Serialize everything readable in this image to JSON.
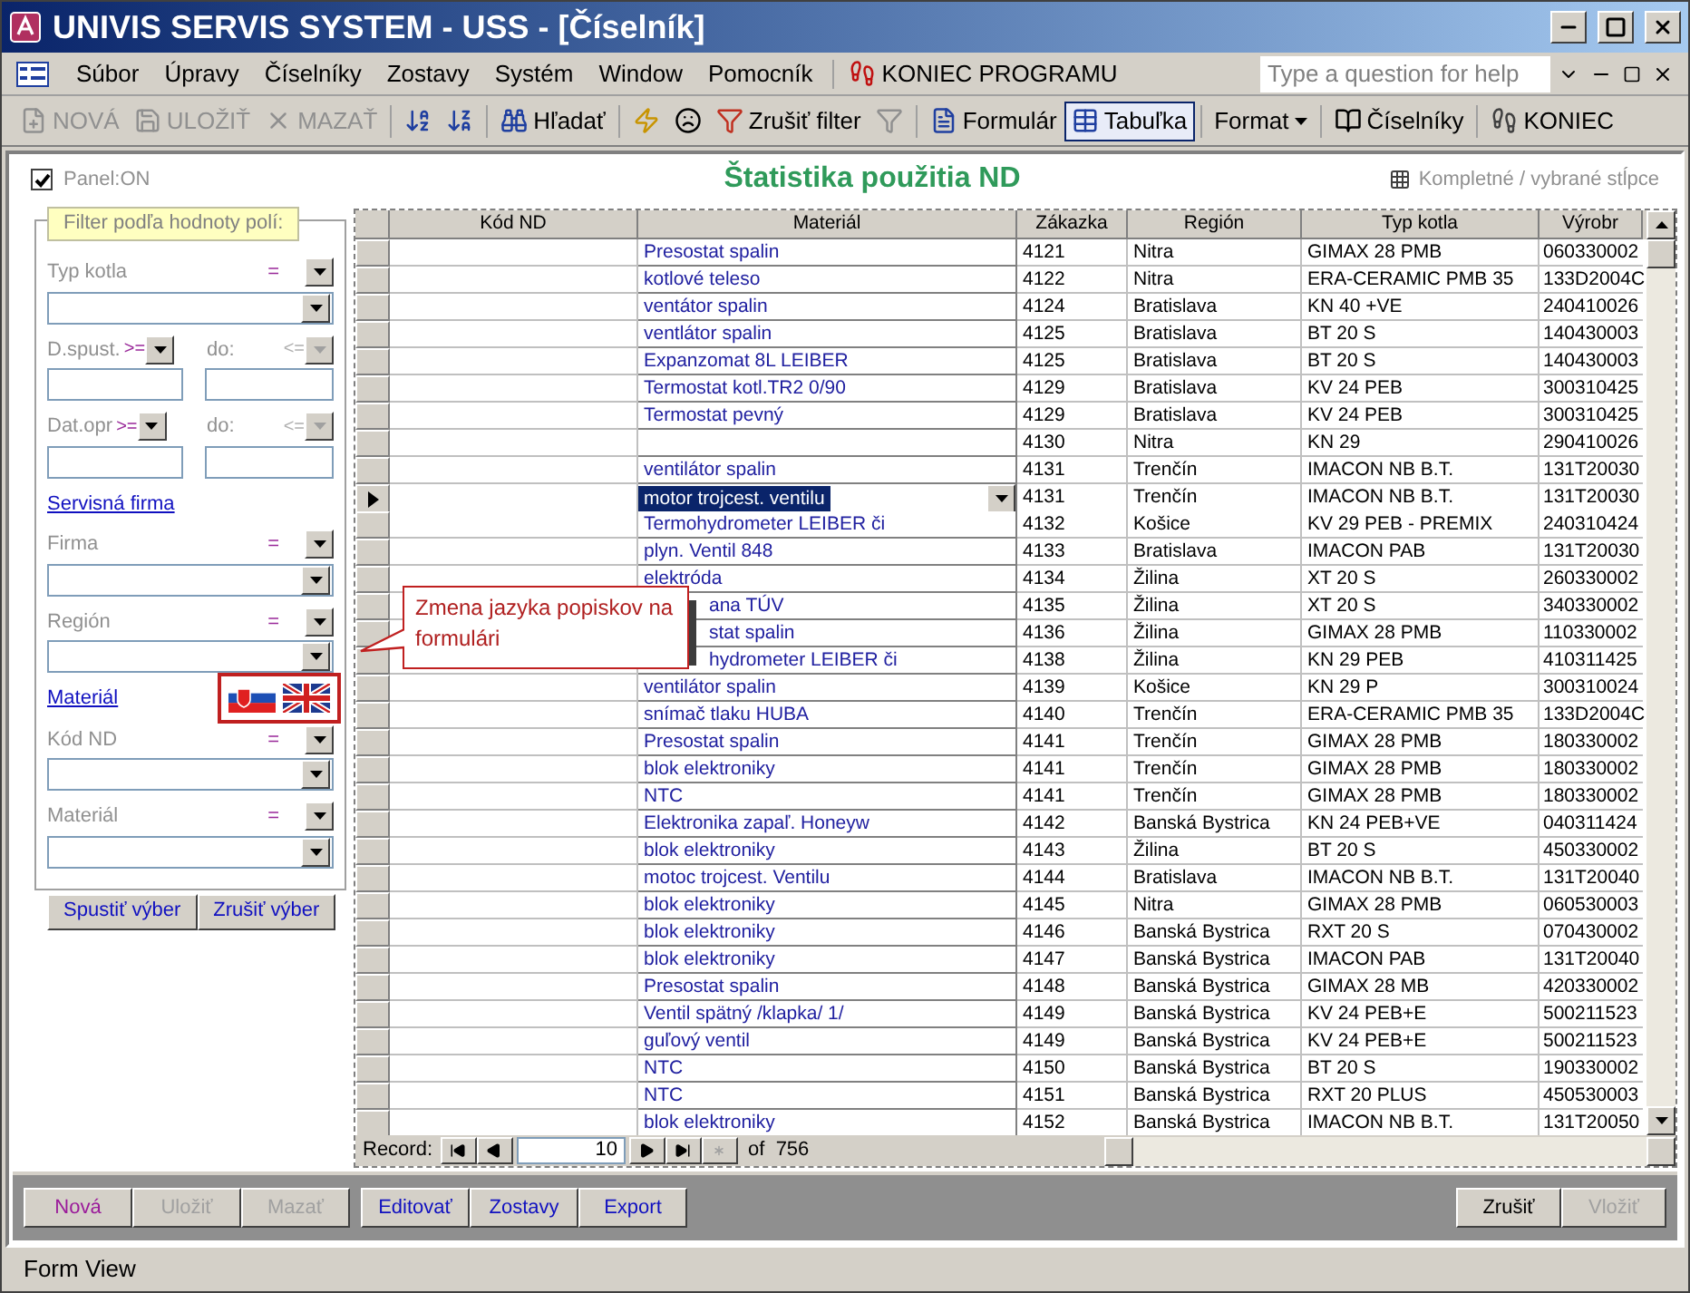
{
  "window": {
    "title": "UNIVIS SERVIS SYSTEM - USS - [Číselník]"
  },
  "menu": {
    "items": [
      "Súbor",
      "Úpravy",
      "Číselníky",
      "Zostavy",
      "Systém",
      "Window",
      "Pomocník"
    ],
    "exit": "KONIEC PROGRAMU",
    "help": {
      "placeholder": "Type a question for help"
    }
  },
  "toolbar": [
    {
      "kind": "new",
      "label": "NOVÁ",
      "disabled": true,
      "selected": false
    },
    {
      "kind": "save",
      "label": "ULOŽIŤ",
      "disabled": true,
      "selected": false
    },
    {
      "kind": "delete",
      "label": "MAZAŤ",
      "disabled": true,
      "selected": false
    },
    {
      "kind": "sortasc",
      "disabled": false,
      "selected": false
    },
    {
      "kind": "sortdesc",
      "disabled": false,
      "selected": false
    },
    {
      "kind": "find",
      "label": "Hľadať",
      "disabled": false,
      "selected": false
    },
    {
      "kind": "lightning",
      "disabled": false,
      "selected": false
    },
    {
      "kind": "face",
      "disabled": false,
      "selected": false
    },
    {
      "kind": "clearfilter",
      "label": "Zrušiť filter",
      "disabled": false,
      "selected": false
    },
    {
      "kind": "filter",
      "disabled": true,
      "selected": false
    },
    {
      "kind": "form",
      "label": "Formulár",
      "disabled": false,
      "selected": false
    },
    {
      "kind": "table",
      "label": "Tabuľka",
      "disabled": false,
      "selected": true
    },
    {
      "kind": "format",
      "label": "Format",
      "disabled": false,
      "selected": false
    },
    {
      "kind": "lists",
      "label": "Číselníky",
      "disabled": false,
      "selected": false
    },
    {
      "kind": "exit",
      "label": "KONIEC",
      "disabled": false,
      "selected": false
    }
  ],
  "header": {
    "panel": {
      "label": "Panel:ON",
      "checked": true
    },
    "title": "Štatistika použitia ND",
    "columns_toggle": "Kompletné / vybrané stĺpce"
  },
  "filter": {
    "legend": "Filter podľa hodnoty polí:",
    "items": [
      {
        "kind": "combo",
        "label": "Typ kotla",
        "operator": "="
      },
      {
        "kind": "range",
        "label": "D.spust.",
        "from_op": ">=",
        "to_label": "do:",
        "to_op": "<=",
        "to_disabled": true
      },
      {
        "kind": "range",
        "label": "Dat.opr",
        "from_op": ">=",
        "to_label": "do:",
        "to_op": "<=",
        "to_disabled": true
      },
      {
        "kind": "link",
        "label": "Servisná firma",
        "language_flags": false
      },
      {
        "kind": "combo",
        "label": "Firma",
        "operator": "="
      },
      {
        "kind": "combo",
        "label": "Región",
        "operator": "="
      },
      {
        "kind": "link",
        "label": "Materiál",
        "language_flags": true
      },
      {
        "kind": "combo",
        "label": "Kód ND",
        "operator": "="
      },
      {
        "kind": "combo",
        "label": "Materiál",
        "operator": "="
      }
    ],
    "buttons": [
      "Spustiť výber",
      "Zrušiť výber"
    ]
  },
  "callout": {
    "text": "Zmena jazyka popiskov na formulári"
  },
  "table": {
    "columns": [
      "Kód ND",
      "Materiál",
      "Zákazka",
      "Región",
      "Typ kotla",
      "Výrobr"
    ],
    "rows": [
      {
        "material": "Presostat spalin",
        "order": "4121",
        "region": "Nitra",
        "boiler": "GIMAX 28 PMB",
        "serial": "060330002",
        "current": false,
        "covered": false
      },
      {
        "material": "kotlové teleso",
        "order": "4122",
        "region": "Nitra",
        "boiler": "ERA-CERAMIC PMB 35",
        "serial": "133D2004C",
        "current": false,
        "covered": false
      },
      {
        "material": "ventátor spalin",
        "order": "4124",
        "region": "Bratislava",
        "boiler": "KN 40 +VE",
        "serial": "240410026",
        "current": false,
        "covered": false
      },
      {
        "material": "ventlátor spalin",
        "order": "4125",
        "region": "Bratislava",
        "boiler": "BT 20 S",
        "serial": "140430003",
        "current": false,
        "covered": false
      },
      {
        "material": "Expanzomat 8L LEIBER",
        "order": "4125",
        "region": "Bratislava",
        "boiler": "BT 20 S",
        "serial": "140430003",
        "current": false,
        "covered": false
      },
      {
        "material": "Termostat kotl.TR2 0/90",
        "order": "4129",
        "region": "Bratislava",
        "boiler": "KV 24 PEB",
        "serial": "300310425",
        "current": false,
        "covered": false
      },
      {
        "material": "Termostat pevný",
        "order": "4129",
        "region": "Bratislava",
        "boiler": "KV 24 PEB",
        "serial": "300310425",
        "current": false,
        "covered": false
      },
      {
        "order": "4130",
        "region": "Nitra",
        "boiler": "KN 29",
        "serial": "290410026",
        "current": false,
        "covered": false
      },
      {
        "material": "ventilátor spalin",
        "order": "4131",
        "region": "Trenčín",
        "boiler": "IMACON NB B.T.",
        "serial": "131T20030",
        "current": false,
        "covered": false
      },
      {
        "material": "motor trojcest. ventilu",
        "order": "4131",
        "region": "Trenčín",
        "boiler": "IMACON NB B.T.",
        "serial": "131T20030",
        "current": true,
        "covered": false
      },
      {
        "material": "Termohydrometer LEIBER či",
        "order": "4132",
        "region": "Košice",
        "boiler": "KV 29 PEB - PREMIX",
        "serial": "240310424",
        "current": false,
        "covered": false
      },
      {
        "material": "plyn. Ventil 848",
        "order": "4133",
        "region": "Bratislava",
        "boiler": "IMACON PAB",
        "serial": "131T20030",
        "current": false,
        "covered": false
      },
      {
        "material": "elektróda",
        "order": "4134",
        "region": "Žilina",
        "boiler": "XT 20 S",
        "serial": "260330002",
        "current": false,
        "covered": false
      },
      {
        "material": "ana  TÚV",
        "order": "4135",
        "region": "Žilina",
        "boiler": "XT 20 S",
        "serial": "340330002",
        "current": false,
        "covered": true
      },
      {
        "material": "stat spalin",
        "order": "4136",
        "region": "Žilina",
        "boiler": "GIMAX 28 PMB",
        "serial": "110330002",
        "current": false,
        "covered": true
      },
      {
        "material": "hydrometer LEIBER či",
        "order": "4138",
        "region": "Žilina",
        "boiler": "KN 29 PEB",
        "serial": "410311425",
        "current": false,
        "covered": true
      },
      {
        "material": "ventilátor spalin",
        "order": "4139",
        "region": "Košice",
        "boiler": "KN 29 P",
        "serial": "300310024",
        "current": false,
        "covered": false
      },
      {
        "material": "snímač tlaku HUBA",
        "order": "4140",
        "region": "Trenčín",
        "boiler": "ERA-CERAMIC PMB 35",
        "serial": "133D2004C",
        "current": false,
        "covered": false
      },
      {
        "material": "Presostat spalin",
        "order": "4141",
        "region": "Trenčín",
        "boiler": "GIMAX 28 PMB",
        "serial": "180330002",
        "current": false,
        "covered": false
      },
      {
        "material": "blok elektroniky",
        "order": "4141",
        "region": "Trenčín",
        "boiler": "GIMAX 28 PMB",
        "serial": "180330002",
        "current": false,
        "covered": false
      },
      {
        "material": "NTC",
        "order": "4141",
        "region": "Trenčín",
        "boiler": "GIMAX 28 PMB",
        "serial": "180330002",
        "current": false,
        "covered": false
      },
      {
        "material": "Elektronika zapaľ. Honeyw",
        "order": "4142",
        "region": "Banská Bystrica",
        "boiler": "KN 24 PEB+VE",
        "serial": "040311424",
        "current": false,
        "covered": false
      },
      {
        "material": "blok elektroniky",
        "order": "4143",
        "region": "Žilina",
        "boiler": "BT 20 S",
        "serial": "450330002",
        "current": false,
        "covered": false
      },
      {
        "material": "motoc trojcest. Ventilu",
        "order": "4144",
        "region": "Bratislava",
        "boiler": "IMACON NB B.T.",
        "serial": "131T20040",
        "current": false,
        "covered": false
      },
      {
        "material": "blok elektroniky",
        "order": "4145",
        "region": "Nitra",
        "boiler": "GIMAX 28 PMB",
        "serial": "060530003",
        "current": false,
        "covered": false
      },
      {
        "material": "blok elektroniky",
        "order": "4146",
        "region": "Banská Bystrica",
        "boiler": "RXT 20 S",
        "serial": "070430002",
        "current": false,
        "covered": false
      },
      {
        "material": "blok elektroniky",
        "order": "4147",
        "region": "Banská Bystrica",
        "boiler": "IMACON PAB",
        "serial": "131T20040",
        "current": false,
        "covered": false
      },
      {
        "material": "Presostat spalin",
        "order": "4148",
        "region": "Banská Bystrica",
        "boiler": "GIMAX 28 MB",
        "serial": "420330002",
        "current": false,
        "covered": false
      },
      {
        "material": "Ventil spätný /klapka/ 1/",
        "order": "4149",
        "region": "Banská Bystrica",
        "boiler": "KV 24 PEB+E",
        "serial": "500211523",
        "current": false,
        "covered": false
      },
      {
        "material": "guľový ventil",
        "order": "4149",
        "region": "Banská Bystrica",
        "boiler": "KV 24 PEB+E",
        "serial": "500211523",
        "current": false,
        "covered": false
      },
      {
        "material": "NTC",
        "order": "4150",
        "region": "Banská Bystrica",
        "boiler": "BT 20 S",
        "serial": "190330002",
        "current": false,
        "covered": false
      },
      {
        "material": "NTC",
        "order": "4151",
        "region": "Banská Bystrica",
        "boiler": "RXT 20 PLUS",
        "serial": "450530003",
        "current": false,
        "covered": false
      },
      {
        "material": "blok elektroniky",
        "order": "4152",
        "region": "Banská Bystrica",
        "boiler": "IMACON NB B.T.",
        "serial": "131T20050",
        "current": false,
        "covered": false
      }
    ]
  },
  "navigator": {
    "label": "Record:",
    "value": "10",
    "total": "of  756"
  },
  "actions": {
    "left": [
      {
        "label": "Nová",
        "disabled": false
      },
      {
        "label": "Uložiť",
        "disabled": true
      },
      {
        "label": "Mazať",
        "disabled": true
      },
      {
        "label": "Editovať",
        "disabled": false
      },
      {
        "label": "Zostavy",
        "disabled": false
      },
      {
        "label": "Export",
        "disabled": false
      }
    ],
    "right": [
      {
        "label": "Zrušiť",
        "disabled": false
      },
      {
        "label": "Vložiť",
        "disabled": true
      }
    ]
  },
  "status_bar": "Form View"
}
